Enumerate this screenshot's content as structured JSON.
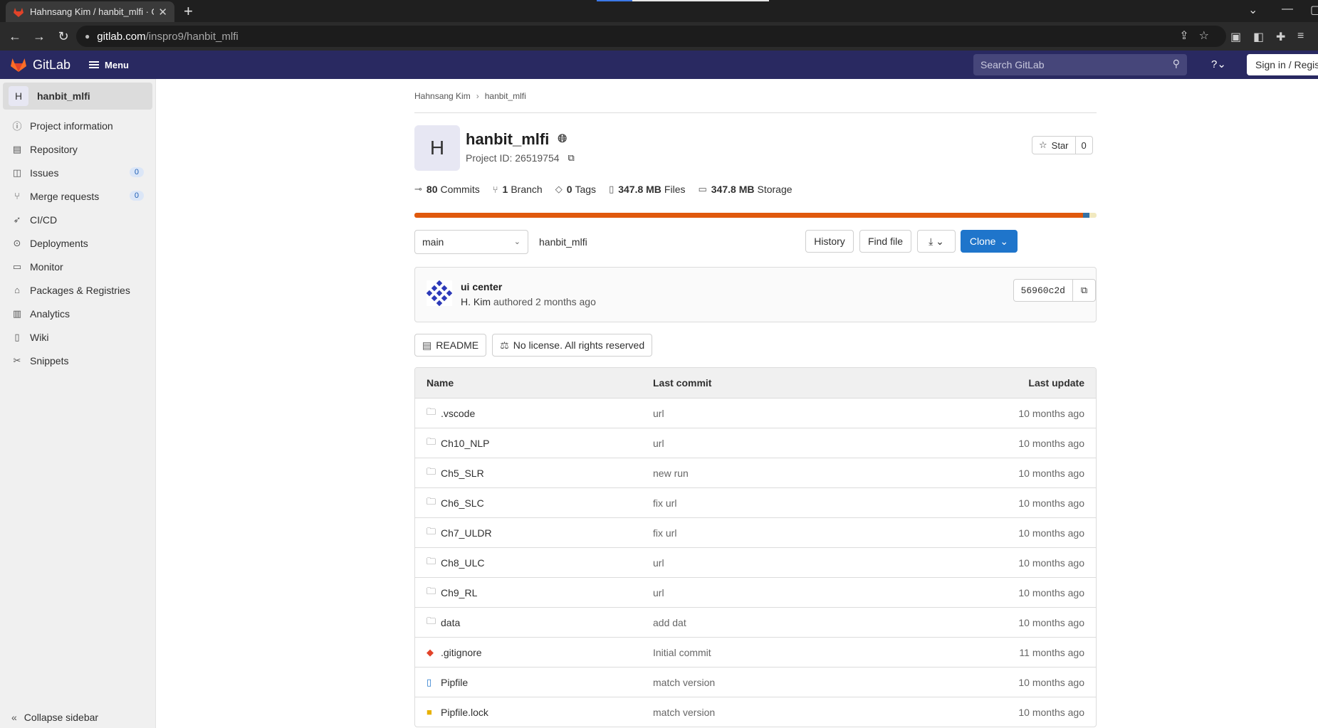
{
  "browser": {
    "tab_title": "Hahnsang Kim / hanbit_mlfi · GitLab",
    "url_domain": "gitlab.com",
    "url_path": "/inspro9/hanbit_mlfi"
  },
  "header": {
    "logo_text": "GitLab",
    "menu_label": "Menu",
    "search_placeholder": "Search GitLab",
    "signin_label": "Sign in / Register",
    "brand_color": "#292961"
  },
  "sidebar": {
    "context_avatar": "H",
    "context_name": "hanbit_mlfi",
    "items": [
      {
        "label": "Project information",
        "icon": "info-icon"
      },
      {
        "label": "Repository",
        "icon": "book-icon"
      },
      {
        "label": "Issues",
        "icon": "issues-icon",
        "badge": "0"
      },
      {
        "label": "Merge requests",
        "icon": "merge-request-icon",
        "badge": "0"
      },
      {
        "label": "CI/CD",
        "icon": "rocket-icon"
      },
      {
        "label": "Deployments",
        "icon": "deployments-icon"
      },
      {
        "label": "Monitor",
        "icon": "monitor-icon"
      },
      {
        "label": "Packages & Registries",
        "icon": "package-icon"
      },
      {
        "label": "Analytics",
        "icon": "chart-icon"
      },
      {
        "label": "Wiki",
        "icon": "wiki-icon"
      },
      {
        "label": "Snippets",
        "icon": "snippet-icon"
      }
    ],
    "collapse_label": "Collapse sidebar"
  },
  "breadcrumb": {
    "owner": "Hahnsang Kim",
    "project": "hanbit_mlfi"
  },
  "project": {
    "avatar": "H",
    "name": "hanbit_mlfi",
    "id_label": "Project ID: 26519754",
    "star_label": "Star",
    "star_count": "0"
  },
  "stats": {
    "commits_count": "80",
    "commits_label": "Commits",
    "branches_count": "1",
    "branches_label": "Branch",
    "tags_count": "0",
    "tags_label": "Tags",
    "files_size": "347.8 MB",
    "files_label": "Files",
    "storage_size": "347.8 MB",
    "storage_label": "Storage"
  },
  "toolbar": {
    "branch": "main",
    "path": "hanbit_mlfi",
    "history_label": "History",
    "find_file_label": "Find file",
    "clone_label": "Clone",
    "accent_color": "#1f75cb"
  },
  "last_commit": {
    "message": "ui center",
    "author": "H. Kim",
    "authored_text": "authored 2 months ago",
    "sha": "56960c2d"
  },
  "chips": {
    "readme_label": "README",
    "license_label": "No license. All rights reserved"
  },
  "file_table": {
    "headers": {
      "name": "Name",
      "last_commit": "Last commit",
      "last_update": "Last update"
    },
    "rows": [
      {
        "name": ".vscode",
        "type": "folder",
        "commit": "url",
        "updated": "10 months ago"
      },
      {
        "name": "Ch10_NLP",
        "type": "folder",
        "commit": "url",
        "updated": "10 months ago"
      },
      {
        "name": "Ch5_SLR",
        "type": "folder",
        "commit": "new run",
        "updated": "10 months ago"
      },
      {
        "name": "Ch6_SLC",
        "type": "folder",
        "commit": "fix url",
        "updated": "10 months ago"
      },
      {
        "name": "Ch7_ULDR",
        "type": "folder",
        "commit": "fix url",
        "updated": "10 months ago"
      },
      {
        "name": "Ch8_ULC",
        "type": "folder",
        "commit": "url",
        "updated": "10 months ago"
      },
      {
        "name": "Ch9_RL",
        "type": "folder",
        "commit": "url",
        "updated": "10 months ago"
      },
      {
        "name": "data",
        "type": "folder",
        "commit": "add dat",
        "updated": "10 months ago"
      },
      {
        "name": ".gitignore",
        "type": "gitignore",
        "commit": "Initial commit",
        "updated": "11 months ago"
      },
      {
        "name": "Pipfile",
        "type": "file",
        "commit": "match version",
        "updated": "10 months ago"
      },
      {
        "name": "Pipfile.lock",
        "type": "lock",
        "commit": "match version",
        "updated": "10 months ago"
      }
    ]
  }
}
